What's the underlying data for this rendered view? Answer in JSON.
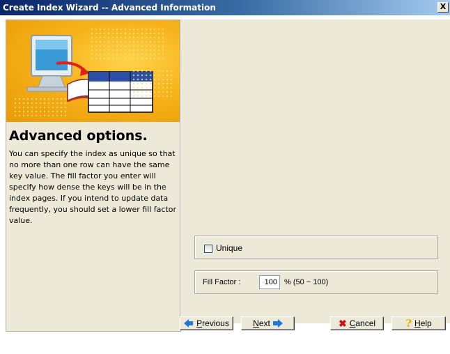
{
  "window": {
    "title": "Create Index Wizard -- Advanced Information",
    "close_glyph": "X"
  },
  "left_panel": {
    "heading": "Advanced options.",
    "description": "You can specify the index as unique so that no more than one row can have the same key value. The fill factor you enter will specify how dense the keys will be in the index pages. If you intend to update data frequently, you should set a lower fill factor value.",
    "banner_icon": "computer-to-table-illustration"
  },
  "options": {
    "unique_label": "Unique",
    "unique_checked": false,
    "fill_factor_label": "Fill Factor :",
    "fill_factor_value": "100",
    "fill_factor_range": "% (50 ~ 100)"
  },
  "buttons": {
    "previous": {
      "label_u": "P",
      "label_rest": "revious",
      "icon": "arrow-left-icon"
    },
    "next": {
      "label_u": "N",
      "label_rest": "ext",
      "icon": "arrow-right-icon"
    },
    "cancel": {
      "label_u": "C",
      "label_rest": "ancel",
      "icon": "x-icon"
    },
    "help": {
      "label_u": "H",
      "label_rest": "elp",
      "icon": "question-icon"
    }
  },
  "colors": {
    "title_bar_start": "#0A246A",
    "banner": "#F7B21A",
    "dialog_bg": "#ECE9D8"
  }
}
